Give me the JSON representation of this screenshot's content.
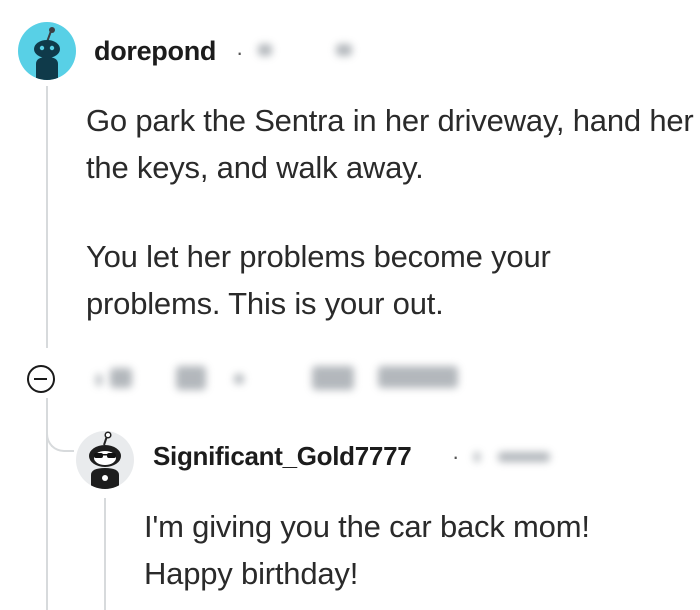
{
  "comment": {
    "username": "dorepond",
    "separator": "·",
    "paragraphs": [
      "Go park the Sentra in her driveway, hand her the keys, and walk away.",
      "You let her problems become your problems. This is your out."
    ]
  },
  "reply": {
    "username": "Significant_Gold7777",
    "separator": "·",
    "lines": [
      "I'm giving you the car back mom!",
      "Happy birthday!"
    ]
  },
  "icons": {
    "collapse": "collapse-minus-icon",
    "avatar1": "reddit-snoo-avatar-icon",
    "avatar2": "reddit-snoo-avatar-icon"
  },
  "colors": {
    "avatar1_bg": "#58d0e6",
    "thread_line": "#d7dadc",
    "text": "#2a2a2a"
  }
}
